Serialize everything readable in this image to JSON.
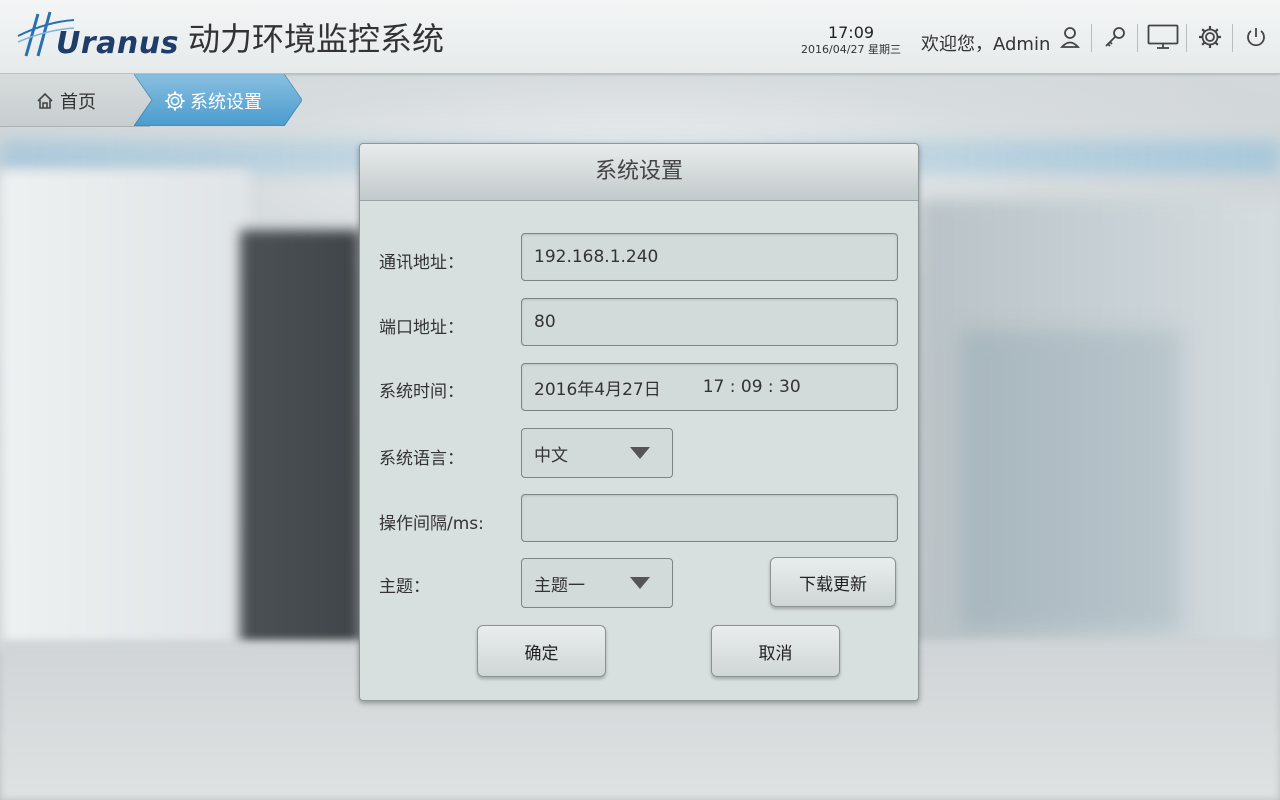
{
  "header": {
    "logo_text": "Uranus",
    "app_title": "动力环境监控系统",
    "time": "17:09",
    "date": "2016/04/27 星期三",
    "welcome": "欢迎您，Admin",
    "icons": [
      "user-icon",
      "key-icon",
      "monitor-icon",
      "gear-icon",
      "power-icon"
    ]
  },
  "breadcrumb": {
    "home_label": "首页",
    "current_label": "系统设置",
    "active_color": "#4a9ccf"
  },
  "dialog": {
    "title": "系统设置",
    "fields": {
      "address_label": "通讯地址：",
      "address_value": "192.168.1.240",
      "port_label": "端口地址：",
      "port_value": "80",
      "time_label": "系统时间：",
      "time_date": "2016年4月27日",
      "time_clock": "17 : 09 : 30",
      "language_label": "系统语言：",
      "language_value": "中文",
      "interval_label": "操作间隔/ms:",
      "interval_value": "",
      "theme_label": "主题：",
      "theme_value": "主题一"
    },
    "download_button": "下载更新",
    "ok_button": "确定",
    "cancel_button": "取消"
  }
}
